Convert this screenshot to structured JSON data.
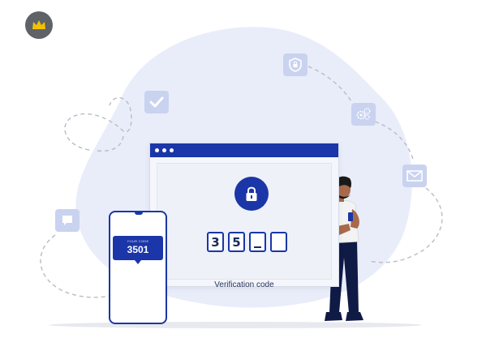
{
  "badge": {
    "icon": "crown-icon",
    "color": "#f2c200"
  },
  "verification": {
    "digits": [
      "3",
      "5",
      "",
      ""
    ],
    "label": "Verification code"
  },
  "phone_message": {
    "caption": "YOUR CODE",
    "code": "3501"
  },
  "icons": [
    "check-icon",
    "shield-lock-icon",
    "gears-icon",
    "mail-icon",
    "chat-bubble-icon",
    "lock-icon"
  ],
  "colors": {
    "brand_blue": "#1b36a8",
    "blob": "#e9edf9",
    "tile": "#c9d3f0"
  }
}
